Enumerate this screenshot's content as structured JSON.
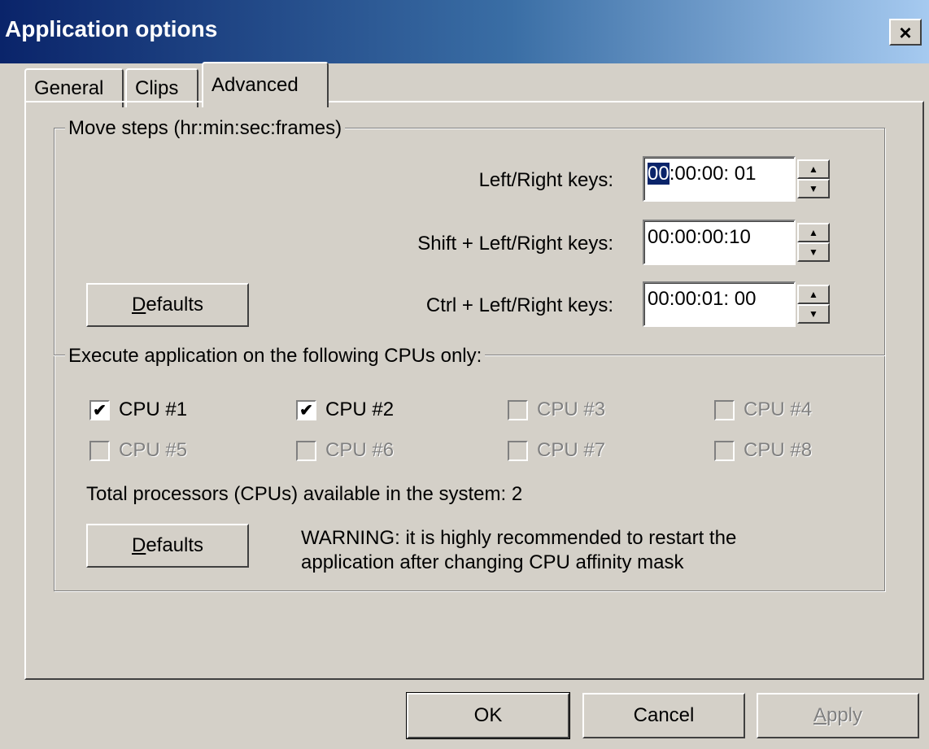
{
  "window": {
    "title": "Application options",
    "close_label": "×"
  },
  "tabs": [
    {
      "label": "General"
    },
    {
      "label": "Clips"
    },
    {
      "label": "Advanced"
    }
  ],
  "move_steps": {
    "legend": "Move steps (hr:min:sec:frames)",
    "rows": [
      {
        "label": "Left/Right keys:",
        "value_selected": "00",
        "value_rest": ":00:00: 01"
      },
      {
        "label": "Shift + Left/Right keys:",
        "value": "00:00:00:10"
      },
      {
        "label": "Ctrl + Left/Right keys:",
        "value": "00:00:01: 00"
      }
    ],
    "defaults_label_accel": "D",
    "defaults_label_rest": "efaults"
  },
  "cpu": {
    "legend": "Execute application on the following CPUs only:",
    "items": [
      {
        "label": "CPU #1",
        "checked": true,
        "enabled": true
      },
      {
        "label": "CPU #2",
        "checked": true,
        "enabled": true
      },
      {
        "label": "CPU #3",
        "checked": false,
        "enabled": false
      },
      {
        "label": "CPU #4",
        "checked": false,
        "enabled": false
      },
      {
        "label": "CPU #5",
        "checked": false,
        "enabled": false
      },
      {
        "label": "CPU #6",
        "checked": false,
        "enabled": false
      },
      {
        "label": "CPU #7",
        "checked": false,
        "enabled": false
      },
      {
        "label": "CPU #8",
        "checked": false,
        "enabled": false
      }
    ],
    "total_text": "Total processors (CPUs) available in the system: 2",
    "defaults_label_accel": "D",
    "defaults_label_rest": "efaults",
    "warning_line1": "WARNING: it is highly recommended to restart the",
    "warning_line2": "application after changing CPU affinity mask"
  },
  "buttons": {
    "ok": "OK",
    "cancel": "Cancel",
    "apply_accel": "A",
    "apply_rest": "pply"
  },
  "spin": {
    "up": "▲",
    "down": "▼"
  },
  "check_mark": "✔"
}
